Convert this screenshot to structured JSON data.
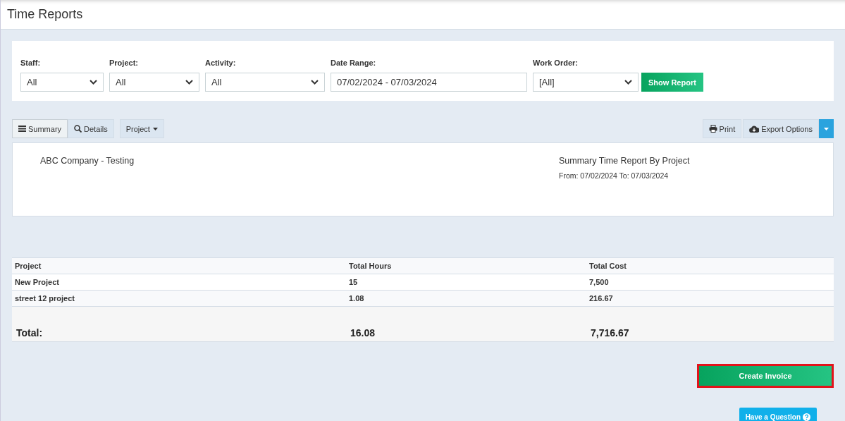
{
  "page_title": "Time Reports",
  "filters": [
    {
      "label": "Staff:",
      "kind": "select",
      "value": "All"
    },
    {
      "label": "Project:",
      "kind": "select",
      "value": "All"
    },
    {
      "label": "Activity:",
      "kind": "select",
      "value": "All"
    },
    {
      "label": "Date Range:",
      "kind": "text",
      "value": "07/02/2024 - 07/03/2024"
    },
    {
      "label": "Work Order:",
      "kind": "select",
      "value": "[All]"
    }
  ],
  "show_report_button": "Show Report",
  "view_tabs": [
    {
      "label": "Summary",
      "selected": true
    },
    {
      "label": "Details",
      "selected": false
    }
  ],
  "group_by_button": "Project",
  "print_button": "Print",
  "export_button": "Export Options",
  "report_header": {
    "company": "ABC Company - Testing",
    "title": "Summary Time Report By Project",
    "period": "From: 07/02/2024 To: 07/03/2024"
  },
  "table": {
    "columns": [
      "Project",
      "Total Hours",
      "Total Cost"
    ],
    "rows": [
      [
        "New Project",
        "15",
        "7,500"
      ],
      [
        "street 12 project",
        "1.08",
        "216.67"
      ]
    ],
    "total": {
      "label": "Total:",
      "hours": "16.08",
      "cost": "7,716.67"
    }
  },
  "create_invoice_button": {
    "label": "Create Invoice",
    "highlighted": true
  },
  "help_button": "Have a Question"
}
